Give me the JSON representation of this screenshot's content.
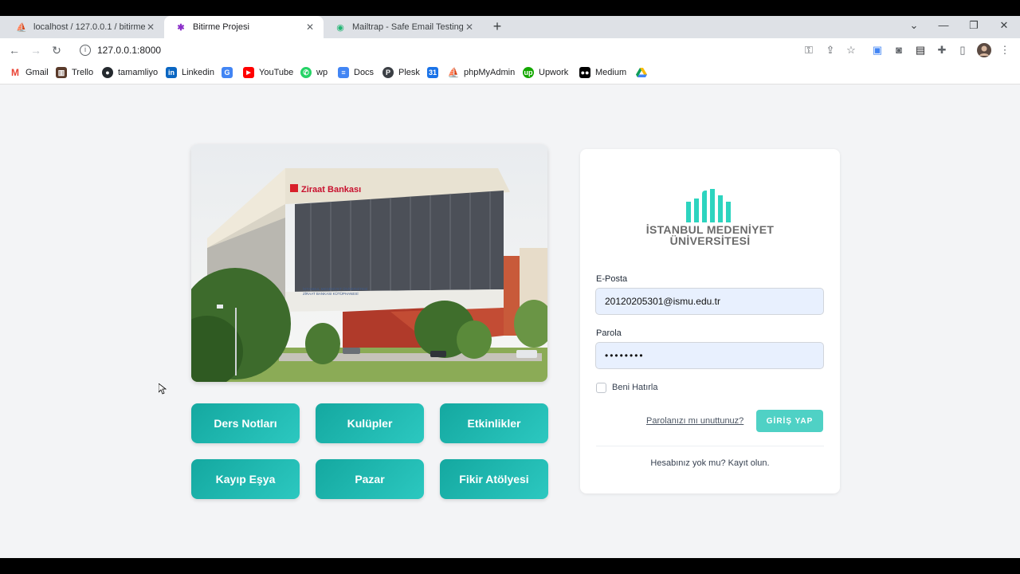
{
  "browser": {
    "tabs": [
      {
        "title": "localhost / 127.0.0.1 / bitirme_proje"
      },
      {
        "title": "Bitirme Projesi"
      },
      {
        "title": "Mailtrap - Safe Email Testing"
      }
    ],
    "tab_close_glyph": "✕",
    "new_tab_glyph": "+",
    "url": "127.0.0.1:8000",
    "bookmarks": [
      {
        "label": "Gmail",
        "icon": "gmail-icon"
      },
      {
        "label": "Trello",
        "icon": "trello-icon"
      },
      {
        "label": "tamamliyo",
        "icon": "github-icon"
      },
      {
        "label": "Linkedin",
        "icon": "linkedin-icon"
      },
      {
        "label": "",
        "icon": "translate-icon"
      },
      {
        "label": "YouTube",
        "icon": "youtube-icon"
      },
      {
        "label": "wp",
        "icon": "whatsapp-icon"
      },
      {
        "label": "Docs",
        "icon": "docs-icon"
      },
      {
        "label": "Plesk",
        "icon": "plesk-icon"
      },
      {
        "label": "",
        "icon": "calendar-icon"
      },
      {
        "label": "phpMyAdmin",
        "icon": "phpmyadmin-icon"
      },
      {
        "label": "Upwork",
        "icon": "upwork-icon"
      },
      {
        "label": "Medium",
        "icon": "medium-icon"
      },
      {
        "label": "",
        "icon": "drive-icon"
      }
    ]
  },
  "page": {
    "tiles": [
      {
        "label": "Ders Notları"
      },
      {
        "label": "Kulüpler"
      },
      {
        "label": "Etkinlikler"
      },
      {
        "label": "Kayıp Eşya"
      },
      {
        "label": "Pazar"
      },
      {
        "label": "Fikir Atölyesi"
      }
    ],
    "photo": {
      "sign": "Ziraat Bankası",
      "plaque_line1": "İSTANBUL MEDENİYET ÜNİVERSİTESİ",
      "plaque_line2": "ZİRAAT BANKASI KÜTÜPHANESİ"
    },
    "login": {
      "logo_line1": "İSTANBUL MEDENİYET",
      "logo_line2": "ÜNİVERSİTESİ",
      "email_label": "E-Posta",
      "email_value": "20120205301@ismu.edu.tr",
      "password_label": "Parola",
      "password_value": "••••••••",
      "remember_label": "Beni Hatırla",
      "forgot_label": "Parolanızı mı unuttunuz?",
      "login_button": "GİRİŞ YAP",
      "register_text": "Hesabınız yok mu? Kayıt olun."
    },
    "colors": {
      "accent": "#4fd1c5",
      "tile": "#1cb5ad",
      "logo": "#2dd4bf"
    }
  }
}
